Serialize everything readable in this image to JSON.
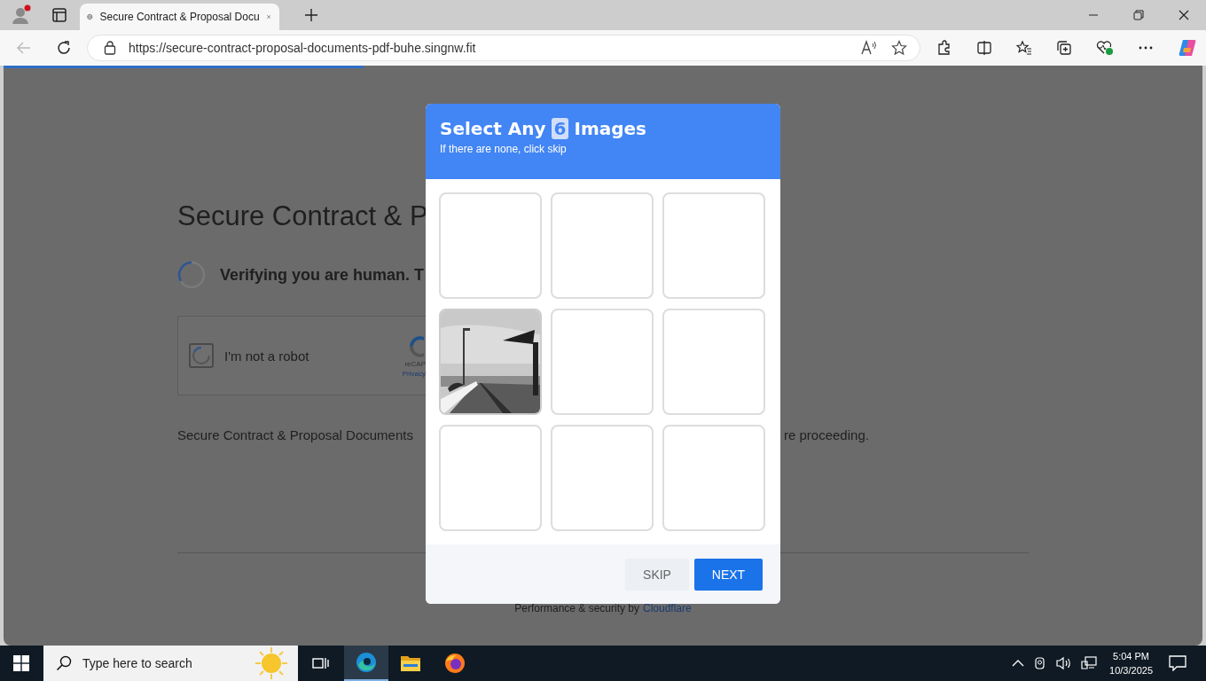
{
  "browser": {
    "tab_title": "Secure Contract & Proposal Docu",
    "address": "https://secure-contract-proposal-documents-pdf-buhe.singnw.fit",
    "load_progress": {
      "level": 0.3
    }
  },
  "page": {
    "title": "Secure Contract & P",
    "status": "Verifying you are human. T",
    "captcha": {
      "checked": false,
      "label": "I'm not a robot",
      "brand": "reCAP",
      "link": "Privacy"
    },
    "note_left": "Secure Contract & Proposal Documents",
    "note_right": "re proceeding.",
    "footer": {
      "text": "Performance & security by",
      "link": "Cloudflare"
    }
  },
  "dialog": {
    "title_before": "Select Any",
    "count": "6",
    "title_after": "Images",
    "subtitle": "If there are none, click skip",
    "tiles": [
      {
        "kind": "empty"
      },
      {
        "kind": "empty"
      },
      {
        "kind": "empty"
      },
      {
        "kind": "picture"
      },
      {
        "kind": "empty"
      },
      {
        "kind": "empty"
      },
      {
        "kind": "empty"
      },
      {
        "kind": "empty"
      },
      {
        "kind": "empty"
      }
    ],
    "buttons": [
      {
        "label": "SKIP",
        "kind": "secondary"
      },
      {
        "label": "NEXT",
        "kind": "primary"
      }
    ]
  },
  "taskbar": {
    "search_placeholder": "Type here to search",
    "apps": [
      {
        "kind": "edge",
        "selected": true
      },
      {
        "kind": "explorer",
        "selected": false
      },
      {
        "kind": "firefox",
        "selected": false
      }
    ],
    "time": "5:04 PM",
    "date": "10/3/2025"
  }
}
